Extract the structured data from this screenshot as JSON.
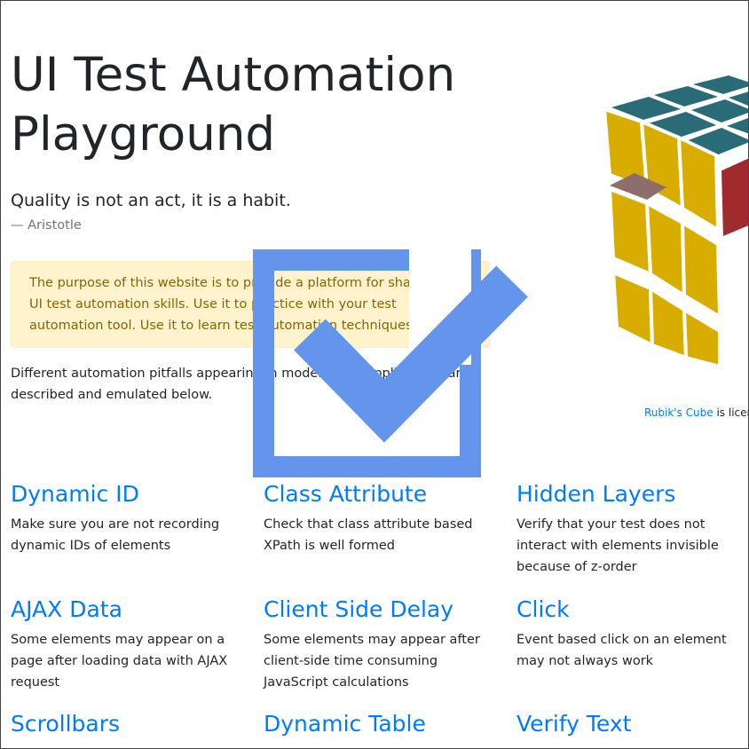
{
  "header": {
    "title": "UI Test Automation Playground",
    "quote": "Quality is not an act, it is a habit.",
    "quote_author": "— Aristotle"
  },
  "alert": {
    "text": "The purpose of this website is to provide a platform for sharpening UI test automation skills. Use it to practice with your test automation tool. Use it to learn test automation techniques."
  },
  "intro": {
    "text": "Different automation pitfalls appearing in modern web applications are described and emulated below."
  },
  "credit": {
    "link_text": "Rubik's Cube",
    "rest": " is licensed"
  },
  "overlay_icon": "checkbox-checked-icon",
  "cube_image": "rubiks-cube-icon",
  "colors": {
    "link": "#007bff",
    "alert_bg": "#fff3cd",
    "alert_text": "#856404",
    "checkmark": "#6495ed"
  },
  "cards": [
    {
      "title": "Dynamic ID",
      "desc": "Make sure you are not recording dynamic IDs of elements"
    },
    {
      "title": "Class Attribute",
      "desc": "Check that class attribute based XPath is well formed"
    },
    {
      "title": "Hidden Layers",
      "desc": "Verify that your test does not interact with elements invisible because of z-order"
    },
    {
      "title": "AJAX Data",
      "desc": "Some elements may appear on a page after loading data with AJAX request"
    },
    {
      "title": "Client Side Delay",
      "desc": "Some elements may appear after client-side time consuming JavaScript calculations"
    },
    {
      "title": "Click",
      "desc": "Event based click on an element may not always work"
    },
    {
      "title": "Scrollbars",
      "desc": ""
    },
    {
      "title": "Dynamic Table",
      "desc": ""
    },
    {
      "title": "Verify Text",
      "desc": ""
    }
  ]
}
